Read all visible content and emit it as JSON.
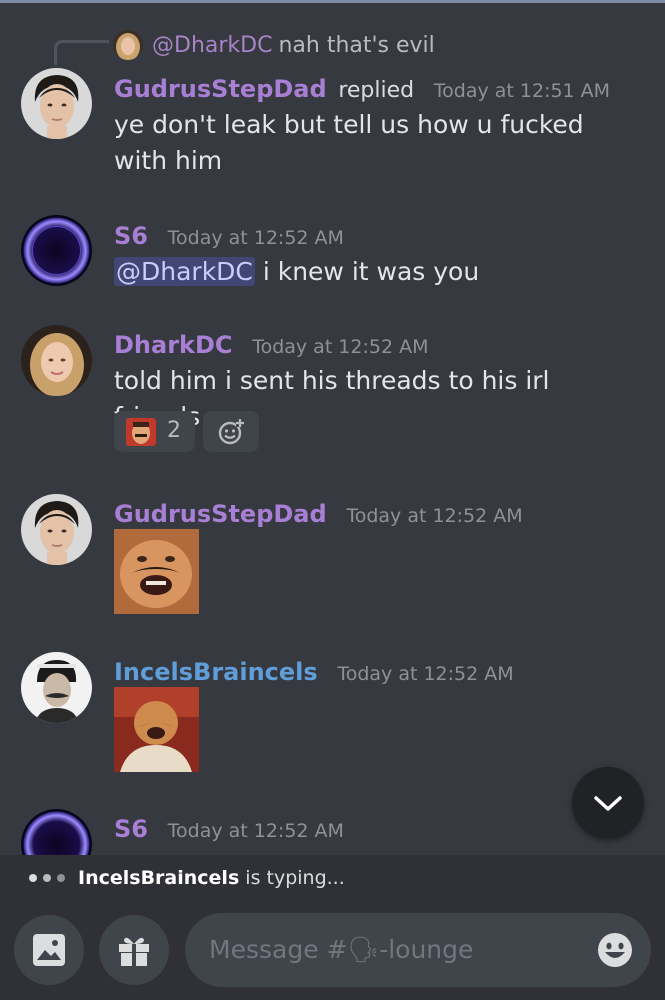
{
  "reply_preview": {
    "mention": "@DharkDC",
    "text": "nah that's evil"
  },
  "messages": [
    {
      "username": "GudrusStepDad",
      "replied": "replied",
      "timestamp": "Today at 12:51 AM",
      "text": "ye don't leak but tell us how u fucked with him"
    },
    {
      "username": "S6",
      "timestamp": "Today at 12:52 AM",
      "mention": "@DharkDC",
      "text": " i knew it was you"
    },
    {
      "username": "DharkDC",
      "timestamp": "Today at 12:52 AM",
      "text": "told him i sent his threads to his irl friends",
      "reaction": {
        "count": "2"
      }
    },
    {
      "username": "GudrusStepDad",
      "timestamp": "Today at 12:52 AM"
    },
    {
      "username": "IncelsBraincels",
      "timestamp": "Today at 12:52 AM"
    },
    {
      "username": "S6",
      "timestamp": "Today at 12:52 AM"
    }
  ],
  "typing": {
    "name": "IncelsBraincels",
    "suffix": " is typing..."
  },
  "composer": {
    "placeholder": "Message #🗣-lounge"
  },
  "colors": {
    "background": "#36393f",
    "purple_user": "#a87fd4",
    "blue_user": "#5f9ed9",
    "mention_bg": "#414675"
  },
  "icons": [
    "image-icon",
    "gift-icon",
    "emoji-icon",
    "add-reaction-icon",
    "chevron-down-icon",
    "typing-dots-icon"
  ]
}
